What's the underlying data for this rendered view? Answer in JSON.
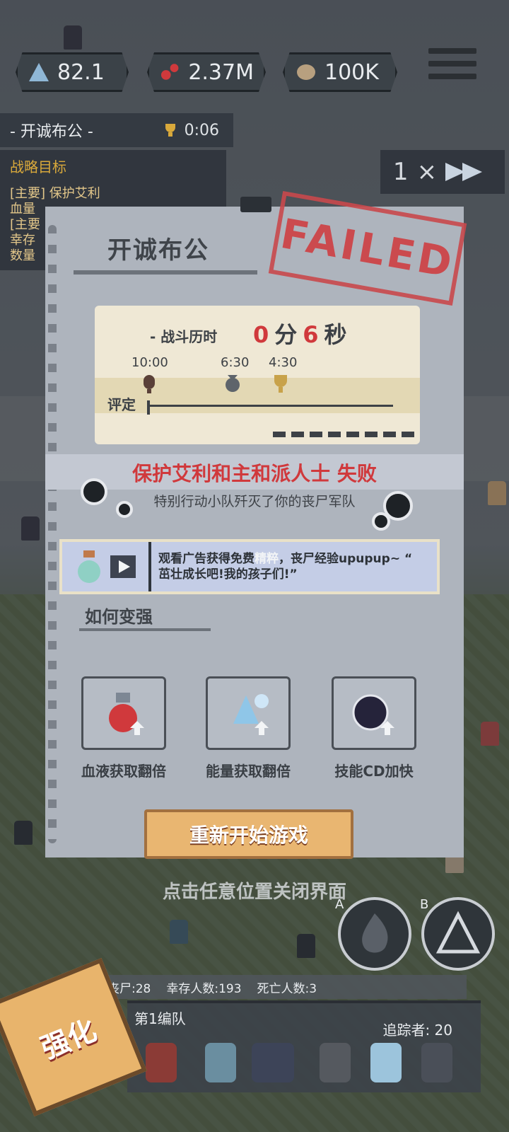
{
  "hud": {
    "energy": "82.1",
    "blood": "2.37M",
    "brains": "100K"
  },
  "level": {
    "name": "- 开诚布公 -",
    "timer": "0:06"
  },
  "objectives": {
    "title": "战略目标",
    "line1": "[主要] 保护艾利",
    "line2": "血量",
    "line3": "[主要",
    "line4": "幸存",
    "line5": "数量"
  },
  "speed": {
    "multiplier": "1",
    "x": "×"
  },
  "panel": {
    "title": "开诚布公",
    "stamp": "FAILED",
    "battle_time_label": "- 战斗历时",
    "minutes": "0",
    "min_unit": "分",
    "seconds": "6",
    "sec_unit": "秒",
    "ticks": [
      "10:00",
      "6:30",
      "4:30"
    ],
    "rating_label": "评定",
    "fail_message": "保护艾利和主和派人士 失败",
    "fail_sub": "特别行动小队歼灭了你的丧尸军队",
    "ad_text_1": "观看广告获得免费",
    "ad_text_highlight": "精粹",
    "ad_text_2": "，丧尸经验upupup~ “",
    "ad_text_3": "茁壮成长吧!我的孩子们!”",
    "howto_title": "如何变强",
    "tips": [
      {
        "label": "血液获取翻倍",
        "icon": "blood-bottle-icon"
      },
      {
        "label": "能量获取翻倍",
        "icon": "energy-crystal-icon"
      },
      {
        "label": "技能CD加快",
        "icon": "skill-orb-icon"
      }
    ],
    "restart_button": "重新开始游戏",
    "close_hint": "点击任意位置关闭界面"
  },
  "skills": {
    "a_label": "A",
    "b_label": "B"
  },
  "bottom": {
    "zombies": "丧尸:28",
    "survivors": "幸存人数:193",
    "dead": "死亡人数:3",
    "squad_name": "第1编队",
    "tracker": "追踪者: 20",
    "upgrade": "强化"
  },
  "colors": {
    "fail_red": "#d0393c",
    "panel_bg": "#aeb4bd",
    "card_bg": "#efe8d5",
    "restart_bg": "#e9b671",
    "objective_gold": "#d9a93b"
  }
}
